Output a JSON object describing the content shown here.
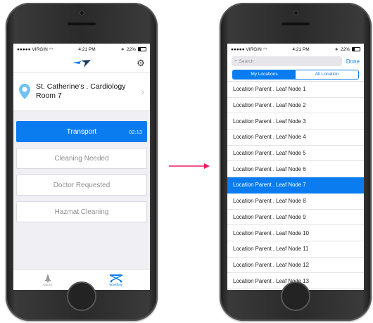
{
  "colors": {
    "accent": "#0a7cf0",
    "arrow": "#e91e63"
  },
  "status_bar": {
    "carrier": "●●●●● VIRGIN",
    "time": "4:21 PM",
    "battery": "22%"
  },
  "left": {
    "location": {
      "name": "St. Catherine's . Cardiology Room 7"
    },
    "tasks": [
      {
        "label": "Transport",
        "timer": "02:13",
        "active": true
      },
      {
        "label": "Cleaning Needed"
      },
      {
        "label": "Doctor Requested"
      },
      {
        "label": "Hazmat Cleaning"
      }
    ],
    "tabs": [
      {
        "label": "Alarms",
        "icon": "bell-icon"
      },
      {
        "label": "Workflow",
        "icon": "stretcher-icon",
        "active": true
      }
    ]
  },
  "right": {
    "search": {
      "placeholder": "Search"
    },
    "done_label": "Done",
    "segments": [
      {
        "label": "My Locations",
        "active": true
      },
      {
        "label": "All Location"
      }
    ],
    "items": [
      "Location Parent . Leaf Node 1",
      "Location Parent . Leaf Node 2",
      "Location Parent . Leaf Node 3",
      "Location Parent . Leaf Node 4",
      "Location Parent . Leaf Node 5",
      "Location Parent . Leaf Node 6",
      "Location Parent . Leaf Node 7",
      "Location Parent . Leaf Node 8",
      "Location Parent . Leaf Node 9",
      "Location Parent . Leaf Node 10",
      "Location Parent . Leaf Node 11",
      "Location Parent . Leaf Node 12",
      "Location Parent . Leaf Node 13"
    ],
    "selected_index": 6
  }
}
